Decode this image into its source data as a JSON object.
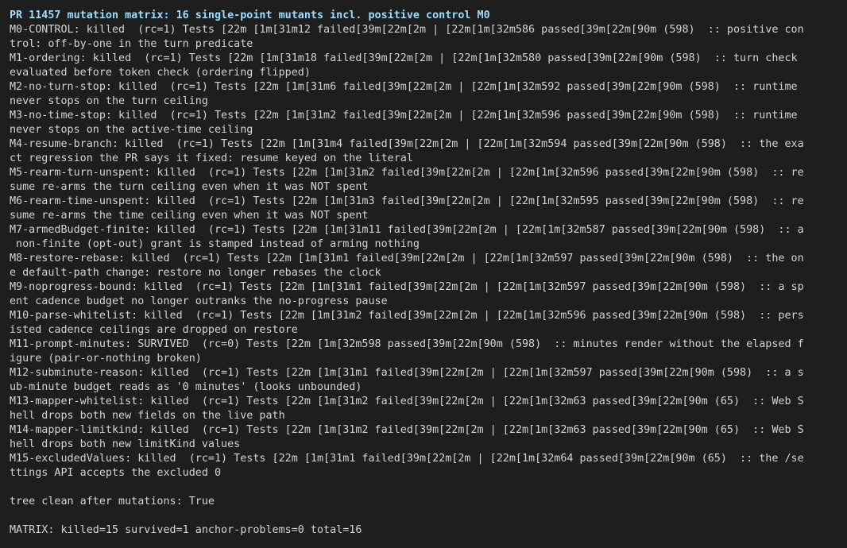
{
  "terminal": {
    "title": "PR 11457 mutation matrix: 16 single-point mutants incl. positive control M0",
    "lines": [
      "M0-CONTROL: killed  (rc=1) Tests [22m [1m[31m12 failed[39m[22m[2m | [22m[1m[32m586 passed[39m[22m[90m (598)  :: positive con",
      "trol: off-by-one in the turn predicate",
      "M1-ordering: killed  (rc=1) Tests [22m [1m[31m18 failed[39m[22m[2m | [22m[1m[32m580 passed[39m[22m[90m (598)  :: turn check",
      "evaluated before token check (ordering flipped)",
      "M2-no-turn-stop: killed  (rc=1) Tests [22m [1m[31m6 failed[39m[22m[2m | [22m[1m[32m592 passed[39m[22m[90m (598)  :: runtime",
      "never stops on the turn ceiling",
      "M3-no-time-stop: killed  (rc=1) Tests [22m [1m[31m2 failed[39m[22m[2m | [22m[1m[32m596 passed[39m[22m[90m (598)  :: runtime",
      "never stops on the active-time ceiling",
      "M4-resume-branch: killed  (rc=1) Tests [22m [1m[31m4 failed[39m[22m[2m | [22m[1m[32m594 passed[39m[22m[90m (598)  :: the exa",
      "ct regression the PR says it fixed: resume keyed on the literal",
      "M5-rearm-turn-unspent: killed  (rc=1) Tests [22m [1m[31m2 failed[39m[22m[2m | [22m[1m[32m596 passed[39m[22m[90m (598)  :: re",
      "sume re-arms the turn ceiling even when it was NOT spent",
      "M6-rearm-time-unspent: killed  (rc=1) Tests [22m [1m[31m3 failed[39m[22m[2m | [22m[1m[32m595 passed[39m[22m[90m (598)  :: re",
      "sume re-arms the time ceiling even when it was NOT spent",
      "M7-armedBudget-finite: killed  (rc=1) Tests [22m [1m[31m11 failed[39m[22m[2m | [22m[1m[32m587 passed[39m[22m[90m (598)  :: a",
      " non-finite (opt-out) grant is stamped instead of arming nothing",
      "M8-restore-rebase: killed  (rc=1) Tests [22m [1m[31m1 failed[39m[22m[2m | [22m[1m[32m597 passed[39m[22m[90m (598)  :: the on",
      "e default-path change: restore no longer rebases the clock",
      "M9-noprogress-bound: killed  (rc=1) Tests [22m [1m[31m1 failed[39m[22m[2m | [22m[1m[32m597 passed[39m[22m[90m (598)  :: a sp",
      "ent cadence budget no longer outranks the no-progress pause",
      "M10-parse-whitelist: killed  (rc=1) Tests [22m [1m[31m2 failed[39m[22m[2m | [22m[1m[32m596 passed[39m[22m[90m (598)  :: pers",
      "isted cadence ceilings are dropped on restore",
      "M11-prompt-minutes: SURVIVED  (rc=0) Tests [22m [1m[32m598 passed[39m[22m[90m (598)  :: minutes render without the elapsed f",
      "igure (pair-or-nothing broken)",
      "M12-subminute-reason: killed  (rc=1) Tests [22m [1m[31m1 failed[39m[22m[2m | [22m[1m[32m597 passed[39m[22m[90m (598)  :: a s",
      "ub-minute budget reads as '0 minutes' (looks unbounded)",
      "M13-mapper-whitelist: killed  (rc=1) Tests [22m [1m[31m2 failed[39m[22m[2m | [22m[1m[32m63 passed[39m[22m[90m (65)  :: Web S",
      "hell drops both new fields on the live path",
      "M14-mapper-limitkind: killed  (rc=1) Tests [22m [1m[31m2 failed[39m[22m[2m | [22m[1m[32m63 passed[39m[22m[90m (65)  :: Web S",
      "hell drops both new limitKind values",
      "M15-excludedValues: killed  (rc=1) Tests [22m [1m[31m1 failed[39m[22m[2m | [22m[1m[32m64 passed[39m[22m[90m (65)  :: the /se",
      "ttings API accepts the excluded 0"
    ],
    "tree_status": "tree clean after mutations: True",
    "matrix_summary": "MATRIX: killed=15 survived=1 anchor-problems=0 total=16",
    "colors": {
      "background": "#1e1e1e",
      "text": "#d4d4d4",
      "title": "#9cdcfe"
    }
  }
}
